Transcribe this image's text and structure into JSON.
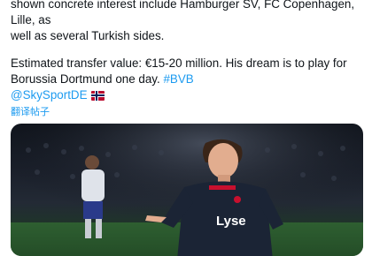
{
  "tweet": {
    "line1": "shown concrete interest include Hamburger SV, FC Copenhagen, Lille, as",
    "line2": "well as several Turkish sides.",
    "para2_text": "Estimated transfer value: €15-20 million. His dream is to play for Borussia Dortmund one day.",
    "hashtag": "#BVB",
    "mention": "@SkySportDE",
    "flag_icon": "norway-flag-icon",
    "translate_label": "翻译帖子"
  },
  "media": {
    "jersey_text": "Lyse",
    "description_colors": {
      "pitch": "#2c5a2e",
      "jersey": "#1b2435",
      "stands": "#1a1f2a"
    }
  }
}
